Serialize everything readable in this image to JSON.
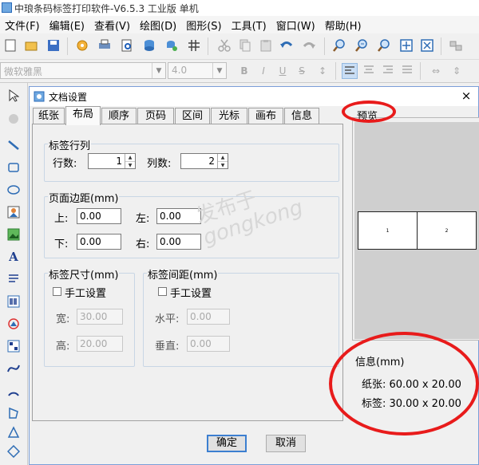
{
  "app": {
    "title": "中琅条码标签打印软件-V6.5.3 工业版 单机"
  },
  "menu": [
    "文件(F)",
    "编辑(E)",
    "查看(V)",
    "绘图(D)",
    "图形(S)",
    "工具(T)",
    "窗口(W)",
    "帮助(H)"
  ],
  "format_bar": {
    "font_name": "微软雅黑",
    "font_size": "4.0"
  },
  "dialog": {
    "title": "文档设置",
    "close": "×",
    "tabs": [
      "纸张",
      "布局",
      "顺序",
      "页码",
      "区间",
      "光标",
      "画布",
      "信息"
    ],
    "active_tab": "布局",
    "rowcol": {
      "title": "标签行列",
      "rows_label": "行数:",
      "rows_value": "1",
      "cols_label": "列数:",
      "cols_value": "2"
    },
    "margins": {
      "title": "页面边距(mm)",
      "top_label": "上:",
      "top": "0.00",
      "left_label": "左:",
      "left": "0.00",
      "bottom_label": "下:",
      "bottom": "0.00",
      "right_label": "右:",
      "right": "0.00"
    },
    "size": {
      "title": "标签尺寸(mm)",
      "manual": "手工设置",
      "width_label": "宽:",
      "width": "30.00",
      "height_label": "高:",
      "height": "20.00"
    },
    "gap": {
      "title": "标签间距(mm)",
      "manual": "手工设置",
      "h_label": "水平:",
      "h": "0.00",
      "v_label": "垂直:",
      "v": "0.00"
    },
    "preview": {
      "label": "预览",
      "cells": [
        "1",
        "2"
      ]
    },
    "info": {
      "title": "信息(mm)",
      "paper": "纸张: 60.00 x 20.00",
      "label": "标签: 30.00 x 20.00"
    },
    "buttons": {
      "ok": "确定",
      "cancel": "取消"
    }
  },
  "watermark": {
    "line1": "发布于",
    "line2": "gongkong"
  },
  "colors": {
    "annotation": "#e81b1b",
    "accent": "#3c7fd0"
  }
}
